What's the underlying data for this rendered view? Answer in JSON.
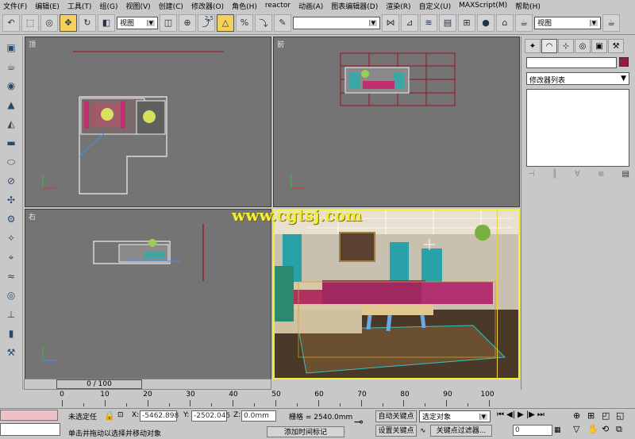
{
  "menu": [
    "文件(F)",
    "编辑(E)",
    "工具(T)",
    "组(G)",
    "视图(V)",
    "创建(C)",
    "修改器(O)",
    "角色(H)",
    "reactor",
    "动画(A)",
    "图表编辑器(D)",
    "渲染(R)",
    "自定义(U)",
    "MAXScript(M)",
    "帮助(H)"
  ],
  "toolbar": {
    "view_select": "视图",
    "snap_value": "2.5",
    "named_select": "",
    "right_view_select": "视图"
  },
  "viewports": {
    "top_label": "顶",
    "front_label": "前",
    "left_label": "右",
    "perspective_watermark": "www.cgtsj.com"
  },
  "command_panel": {
    "modifier_list": "修改器列表"
  },
  "timeline": {
    "slider_label": "0 / 100",
    "ticks": [
      "0",
      "10",
      "20",
      "30",
      "40",
      "50",
      "60",
      "70",
      "80",
      "90",
      "100"
    ]
  },
  "status": {
    "selection": "未选定任",
    "x_label": "X:",
    "x_value": "-5462.898",
    "y_label": "Y:",
    "y_value": "-2502.045",
    "z_label": "Z:",
    "z_value": "0.0mm",
    "grid": "栅格 = 2540.0mm",
    "prompt": "单击并拖动以选择并移动对象",
    "add_time_tag": "添加时间标记",
    "auto_key": "自动关键点",
    "set_key": "设置关键点",
    "selected_object": "选定对象",
    "key_filters": "关键点过滤器...",
    "frame": "0"
  },
  "colors": {
    "viewport_bg": "#747474",
    "active_border": "#f3ee36",
    "wireframe_white": "#f0f0f0",
    "wireframe_red": "#9a1020",
    "watermark": "#f3ee36"
  }
}
